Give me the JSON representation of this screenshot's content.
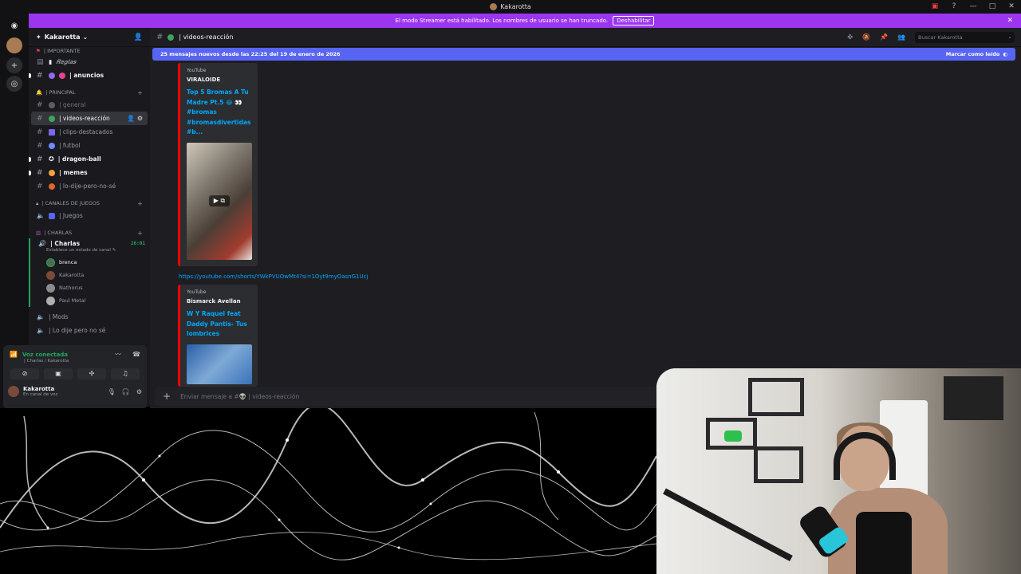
{
  "window": {
    "title": "Kakarotta"
  },
  "banner": {
    "text": "El modo Streamer está habilitado. Los nombres de usuario se han truncado.",
    "button": "Deshabilitar"
  },
  "server": {
    "name": "Kakarotta"
  },
  "sidebar": {
    "categories": {
      "importante": "| IMPORTANTE",
      "principal": "| PRINCIPAL",
      "juegos": "| CANALES DE JUEGOS",
      "charlas": "| CHARLAS"
    },
    "channels": {
      "reglas": "𝑹𝒆𝒈𝒍𝒂𝒔",
      "anuncios": "| anuncios",
      "general": "| general",
      "videos": "| videos-reacción",
      "clips": "| clips-destacados",
      "futbol": "| futbol",
      "dragon": "| dragon-ball",
      "memes": "| memes",
      "lodije": "| lo-dije-pero-no-sé",
      "juegos": "| Juegos",
      "charlas": "| Charlas",
      "charlas_timer": "26:01",
      "charlas_status": "Establece un estado de canal",
      "mods": "| Mods",
      "lodije_voice": "| Lo dije pero no sé"
    },
    "voice_users": [
      "brenca",
      "Kakarotta",
      "Nathorus",
      "Paul Metal"
    ]
  },
  "voice_panel": {
    "status": "Voz conectada",
    "location": "| Charlas / Kakarotta"
  },
  "user": {
    "name": "Kakarotta",
    "status": "En canal de voz"
  },
  "chat": {
    "channel": "| videos-reacción",
    "search_placeholder": "Buscar Kakarotta",
    "new_messages": "25 mensajes nuevos desde las 22:25 del 19 de enero de 2026",
    "mark_read": "Marcar como leído",
    "embed1": {
      "provider": "YouTube",
      "author": "VIRALOIDE",
      "title": "Top 5 Bromas A Tu Madre Pt.5 😂 👀 #bromas #bromasdivertidas #b..."
    },
    "link": "https://youtube.com/shorts/YWkPVUOwMt4?si=1Oyt9myOasnG1Ucj",
    "embed2": {
      "provider": "YouTube",
      "author": "Bismarck Avellan",
      "title": "W Y Raquel feat Daddy Pantis- Tus lombrices"
    },
    "composer_placeholder": "Enviar mensaje a #👽 | videos-reacción"
  },
  "colors": {
    "accent": "#5865f2",
    "streamer_banner": "#9b35f0",
    "voice_green": "#23a55a"
  }
}
